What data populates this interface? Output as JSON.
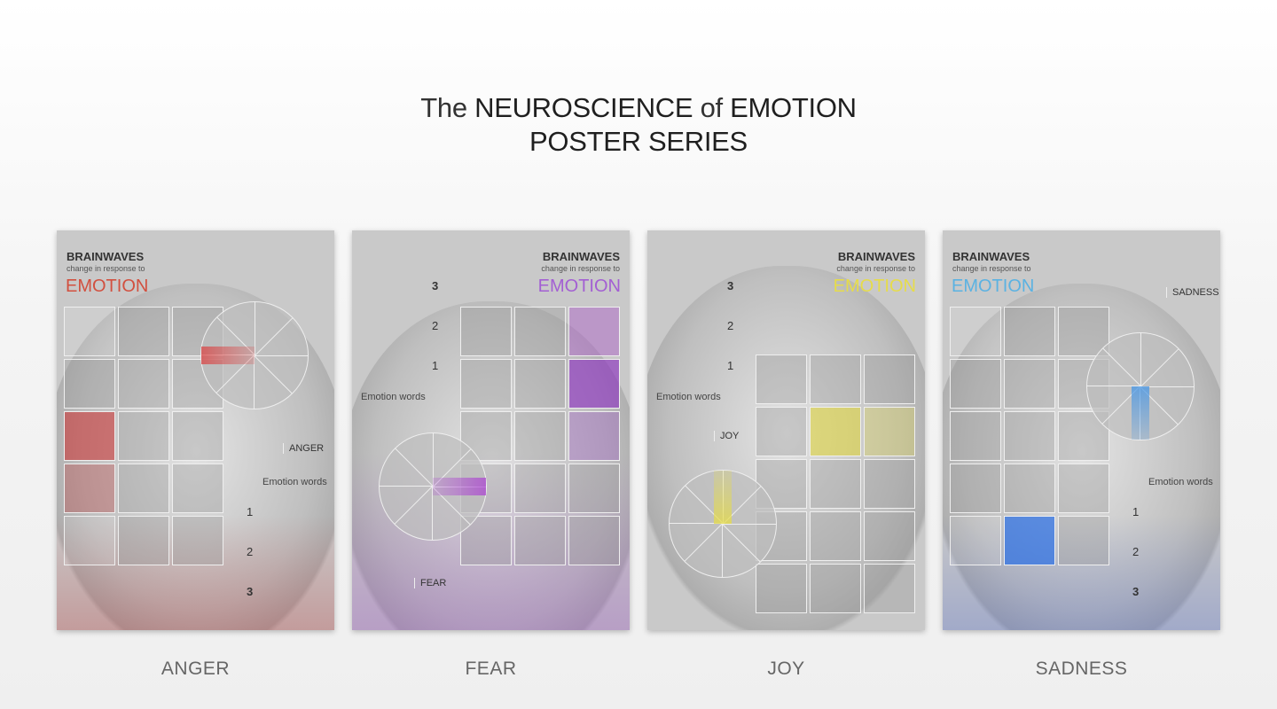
{
  "title": {
    "line1_pre": "The ",
    "line1_b1": "NEUROSCIENCE",
    "line1_mid": " of ",
    "line1_b2": "EMOTION",
    "line2": "POSTER SERIES"
  },
  "posters": [
    {
      "key": "anger",
      "caption": "ANGER",
      "brainwaves": "BRAINWAVES",
      "change": "change in response to",
      "emotion": "EMOTION",
      "emotion_color": "#d2503f",
      "tint": "rgba(180,40,40,0.25)",
      "state_label": "ANGER",
      "emotion_words": "Emotion words",
      "level1": "1",
      "level2": "2",
      "level3": "3"
    },
    {
      "key": "fear",
      "caption": "FEAR",
      "brainwaves": "BRAINWAVES",
      "change": "change in response to",
      "emotion": "EMOTION",
      "emotion_color": "#a35fd3",
      "tint": "rgba(150,80,190,0.3)",
      "state_label": "FEAR",
      "emotion_words": "Emotion words",
      "level1": "1",
      "level2": "2",
      "level3": "3"
    },
    {
      "key": "joy",
      "caption": "JOY",
      "brainwaves": "BRAINWAVES",
      "change": "change in response to",
      "emotion": "EMOTION",
      "emotion_color": "#e6dc4a",
      "tint": "rgba(200,200,120,0.15)",
      "state_label": "JOY",
      "emotion_words": "Emotion words",
      "level1": "1",
      "level2": "2",
      "level3": "3"
    },
    {
      "key": "sadness",
      "caption": "SADNESS",
      "brainwaves": "BRAINWAVES",
      "change": "change in response to",
      "emotion": "EMOTION",
      "emotion_color": "#5bb2e2",
      "tint": "rgba(60,90,200,0.25)",
      "state_label": "SADNESS",
      "emotion_words": "Emotion words",
      "level1": "1",
      "level2": "2",
      "level3": "3"
    }
  ]
}
